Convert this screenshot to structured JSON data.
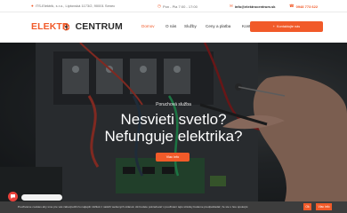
{
  "topbar": {
    "address": "ITS-Elektrik, s.r.o., Liptovská 1173/2, 90001 Senec",
    "hours": "Pon - Pia 7:00 - 17:00",
    "email": "info@elektrocentrum.sk",
    "phone": "0948 773 622"
  },
  "navbar": {
    "logo_part1": "ELEKTR",
    "logo_part2": "CENTRUM",
    "menu": [
      "Domov",
      "O nás",
      "Služby",
      "Ceny a platba",
      "Kontakt"
    ],
    "cta_label": "Kontaktujte nás"
  },
  "hero": {
    "eyebrow": "Poruchová služba",
    "line1": "Nesvieti svetlo?",
    "line2": "Nefunguje elektrika?",
    "button_label": "Viac info"
  },
  "cookie": {
    "text": "Používame cookies aby sme pre vás zabezpečili čo najlepší zážitok z našich webových stránok. Ak budete pokračovať v používaní tejto stránky budeme predpokladať, že ste s ňou spokojní.",
    "ok_label": "Ok",
    "more_label": "Viac info"
  },
  "colors": {
    "accent": "#f15a29",
    "dark": "#2a2a2a"
  }
}
